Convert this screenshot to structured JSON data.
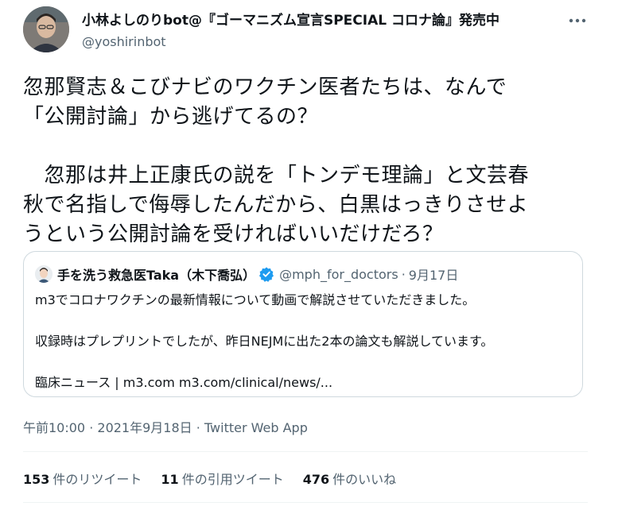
{
  "author": {
    "display_name": "小林よしのりbot@『ゴーマニズム宣言SPECIAL コロナ論』発売中",
    "handle": "@yoshirinbot"
  },
  "tweet": {
    "lines": [
      "忽那賢志＆こびナビのワクチン医者たちは、なんで",
      "「公開討論」から逃げてるの？",
      "　忽那は井上正康氏の説を「トンデモ理論」と文芸春",
      "秋で名指しで侮辱したんだから、白黒はっきりさせよ",
      "うという公開討論を受ければいいだけだろ？"
    ]
  },
  "quoted": {
    "name": "手を洗う救急医Taka（木下喬弘）",
    "handle": "@mph_for_doctors",
    "separator": "·",
    "date": "9月17日",
    "lines": [
      "m3でコロナワクチンの最新情報について動画で解説させていただきました。",
      "収録時はプレプリントでしたが、昨日NEJMに出た2本の論文も解説しています。",
      "臨床ニュース | m3.com m3.com/clinical/news/..."
    ]
  },
  "timestamp": {
    "time": "午前10:00",
    "separator1": " · ",
    "date": "2021年9月18日",
    "separator2": " · ",
    "source": "Twitter Web App"
  },
  "stats": [
    {
      "count": "153",
      "label": "件のリツイート"
    },
    {
      "count": "11",
      "label": "件の引用ツイート"
    },
    {
      "count": "476",
      "label": "件のいいね"
    }
  ],
  "icons": {
    "more": "more-horizontal-icon",
    "verified": "verified-badge-icon",
    "verified_color": "#1d9bf0"
  }
}
